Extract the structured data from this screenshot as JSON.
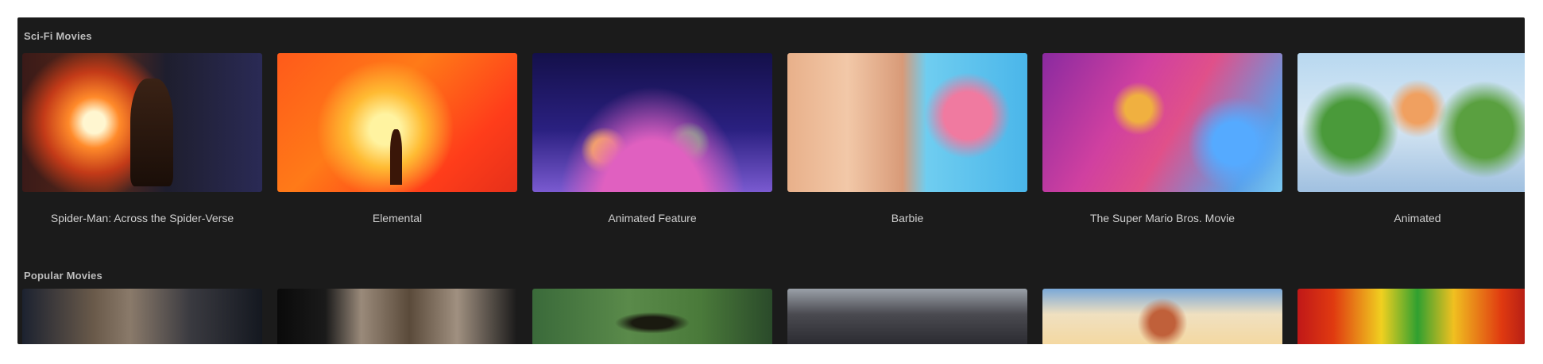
{
  "sections": [
    {
      "title": "Sci-Fi Movies",
      "items": [
        {
          "title": "Spider-Man: Across the Spider-Verse",
          "art": "fiery-explosion-silhouette"
        },
        {
          "title": "Elemental",
          "art": "orange-flame-scene"
        },
        {
          "title": "Animated Feature",
          "art": "colorful-night-crowd"
        },
        {
          "title": "Barbie",
          "art": "pink-blue-portraits"
        },
        {
          "title": "The Super Mario Bros. Movie",
          "art": "purple-sky-adventure"
        },
        {
          "title": "Animated",
          "art": "green-characters-sky"
        }
      ]
    },
    {
      "title": "Popular Movies",
      "items": [
        {
          "title": "",
          "art": "dark-group-portrait"
        },
        {
          "title": "",
          "art": "black-white-action"
        },
        {
          "title": "",
          "art": "green-silhouette"
        },
        {
          "title": "",
          "art": "grey-urban-scene"
        },
        {
          "title": "",
          "art": "bright-beach-scene"
        },
        {
          "title": "",
          "art": "red-yellow-title-art"
        }
      ]
    }
  ]
}
